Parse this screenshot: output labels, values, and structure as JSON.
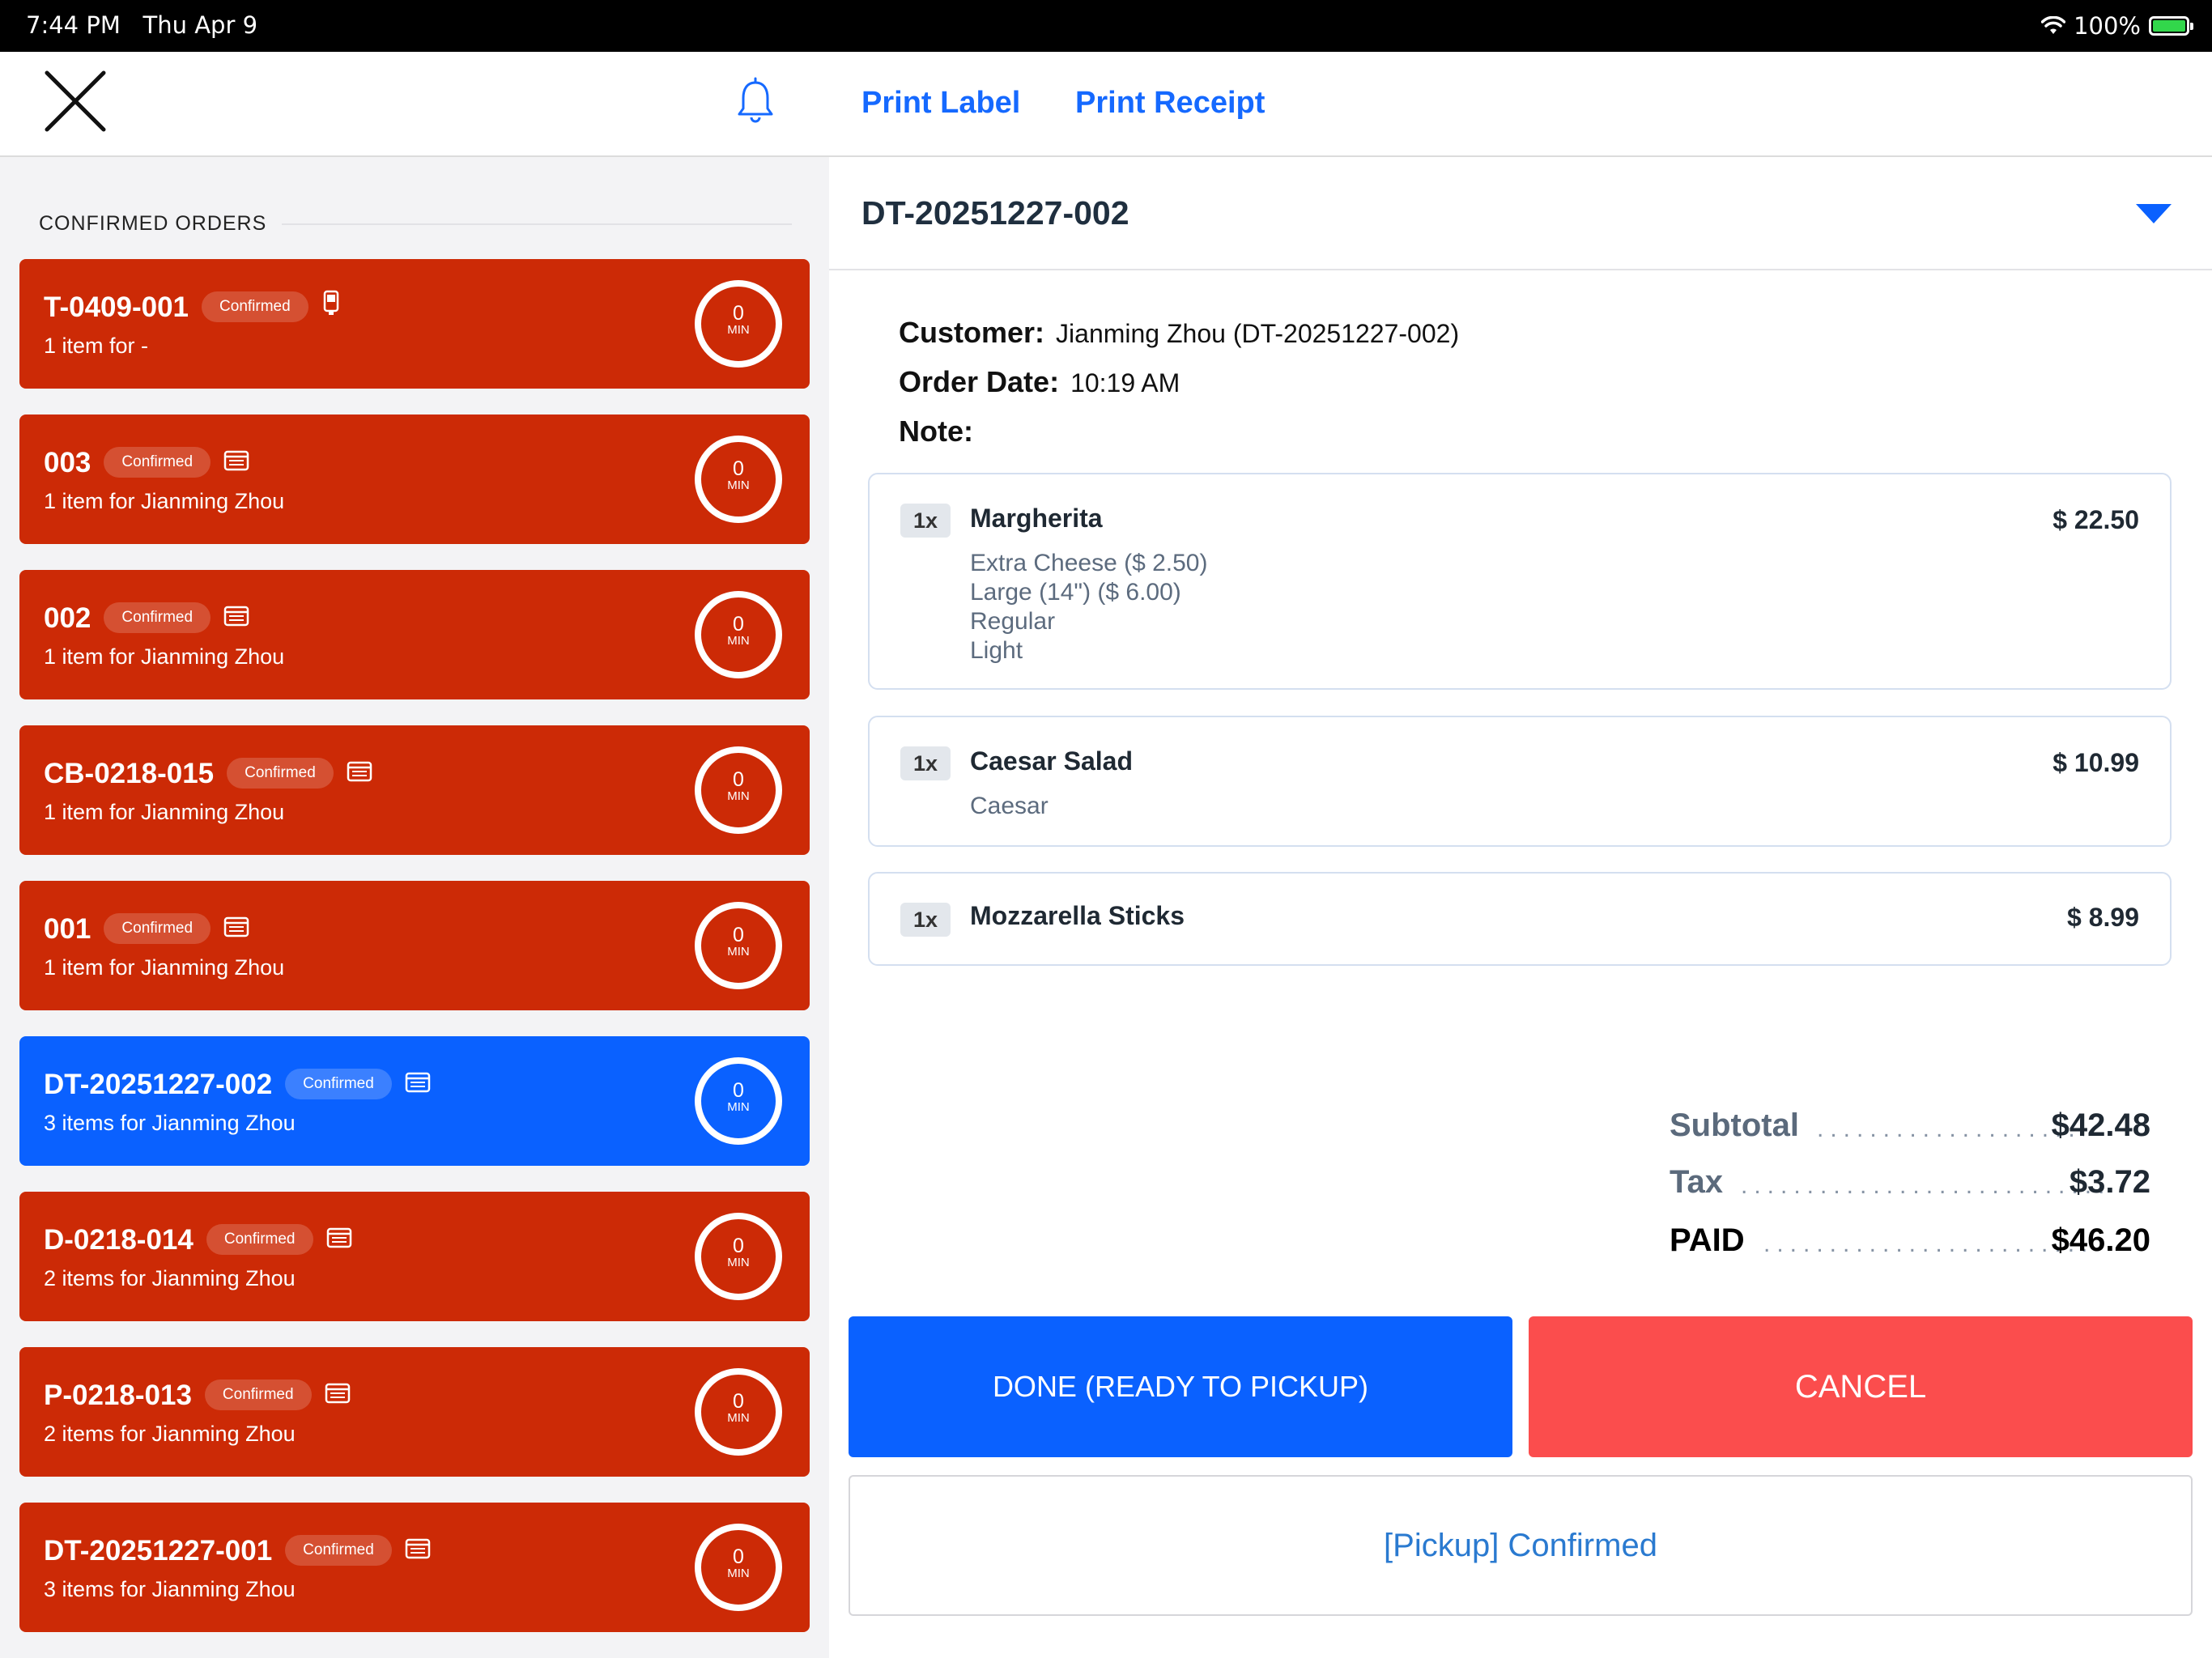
{
  "status_bar": {
    "time": "7:44 PM",
    "date": "Thu Apr 9",
    "battery": "100%",
    "battery_color": "#32d74b"
  },
  "toolbar": {
    "print_label": "Print Label",
    "print_receipt": "Print Receipt",
    "close_icon": "close-x-icon",
    "bell_icon": "bell-icon"
  },
  "left": {
    "section_title": "CONFIRMED ORDERS",
    "orders": [
      {
        "id": "T-0409-001",
        "status": "Confirmed",
        "icon": "phone-device-icon",
        "summary": "1 item for -",
        "timer": "0",
        "timer_unit": "MIN",
        "selected": false
      },
      {
        "id": "003",
        "status": "Confirmed",
        "icon": "receipt-card-icon",
        "summary": "1 item for Jianming Zhou",
        "timer": "0",
        "timer_unit": "MIN",
        "selected": false
      },
      {
        "id": "002",
        "status": "Confirmed",
        "icon": "receipt-card-icon",
        "summary": "1 item for Jianming Zhou",
        "timer": "0",
        "timer_unit": "MIN",
        "selected": false
      },
      {
        "id": "CB-0218-015",
        "status": "Confirmed",
        "icon": "receipt-card-icon",
        "summary": "1 item for Jianming Zhou",
        "timer": "0",
        "timer_unit": "MIN",
        "selected": false
      },
      {
        "id": "001",
        "status": "Confirmed",
        "icon": "receipt-card-icon",
        "summary": "1 item for Jianming Zhou",
        "timer": "0",
        "timer_unit": "MIN",
        "selected": false
      },
      {
        "id": "DT-20251227-002",
        "status": "Confirmed",
        "icon": "receipt-card-icon",
        "summary": "3 items for Jianming Zhou",
        "timer": "0",
        "timer_unit": "MIN",
        "selected": true
      },
      {
        "id": "D-0218-014",
        "status": "Confirmed",
        "icon": "receipt-card-icon",
        "summary": "2 items for Jianming Zhou",
        "timer": "0",
        "timer_unit": "MIN",
        "selected": false
      },
      {
        "id": "P-0218-013",
        "status": "Confirmed",
        "icon": "receipt-card-icon",
        "summary": "2 items for Jianming Zhou",
        "timer": "0",
        "timer_unit": "MIN",
        "selected": false
      },
      {
        "id": "DT-20251227-001",
        "status": "Confirmed",
        "icon": "receipt-card-icon",
        "summary": "3 items for Jianming Zhou",
        "timer": "0",
        "timer_unit": "MIN",
        "selected": false
      }
    ],
    "card_color": "#cc2a06",
    "selected_color": "#0a61ff"
  },
  "detail": {
    "order_id": "DT-20251227-002",
    "customer_label": "Customer:",
    "customer_value": "Jianming Zhou (DT-20251227-002)",
    "date_label": "Order Date:",
    "date_value": "10:19 AM",
    "note_label": "Note:",
    "items": [
      {
        "qty": "1x",
        "name": "Margherita",
        "price": "$ 22.50",
        "mods": [
          "Extra Cheese ($ 2.50)",
          "Large (14\") ($ 6.00)",
          "Regular",
          "Light"
        ]
      },
      {
        "qty": "1x",
        "name": "Caesar Salad",
        "price": "$ 10.99",
        "mods": [
          "Caesar"
        ]
      },
      {
        "qty": "1x",
        "name": "Mozzarella Sticks",
        "price": "$ 8.99",
        "mods": []
      }
    ],
    "totals": {
      "subtotal_label": "Subtotal",
      "subtotal": "$42.48",
      "tax_label": "Tax",
      "tax": "$3.72",
      "paid_label": "PAID",
      "paid": "$46.20"
    },
    "buttons": {
      "done": "DONE (READY TO PICKUP)",
      "cancel": "CANCEL",
      "status": "[Pickup] Confirmed"
    },
    "colors": {
      "done": "#0a61ff",
      "cancel": "#fb4d4d",
      "link": "#1569ff"
    }
  }
}
